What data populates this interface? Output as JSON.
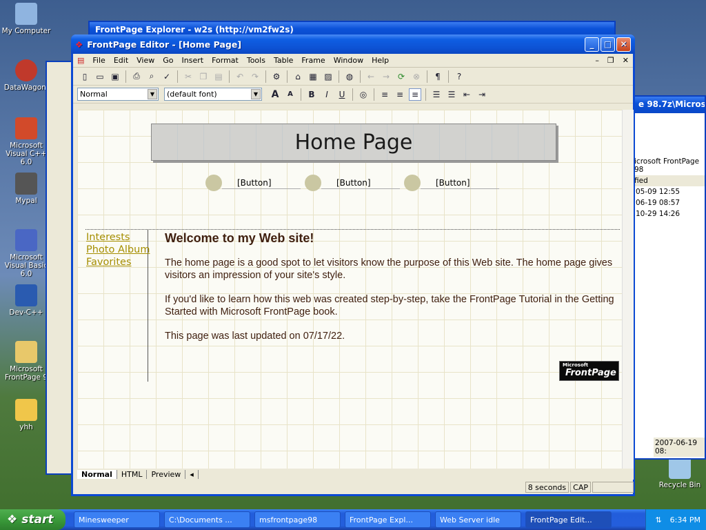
{
  "desktop": {
    "icons": [
      {
        "label": "My Computer",
        "color": "#8fb4e0"
      },
      {
        "label": "DataWagon.",
        "color": "#c0392b"
      },
      {
        "label": "Microsoft Visual C++ 6.0",
        "color": "#d24a2a"
      },
      {
        "label": "Mypal",
        "color": "#555555"
      },
      {
        "label": "Microsoft Visual Basic 6.0",
        "color": "#4a67c4"
      },
      {
        "label": "Dev-C++",
        "color": "#2a5bb0"
      },
      {
        "label": "Microsoft FrontPage 9",
        "color": "#e8c86a"
      },
      {
        "label": "yhh",
        "color": "#f0c64a"
      }
    ],
    "recycle_bin": "Recycle Bin"
  },
  "background_windows": {
    "explorer_title": "FrontPage Explorer - w2s (http://vm2fw2s)",
    "right_title": "e 98.7z\\Microsof",
    "right_header": "icrosoft FrontPage 98",
    "right_col": "fied",
    "right_rows": [
      "05-09 12:55",
      "06-19 08:57",
      "10-29 14:26"
    ],
    "right_status": "2007-06-19 08:"
  },
  "window": {
    "title": "FrontPage Editor - [Home Page]",
    "menu": [
      "File",
      "Edit",
      "View",
      "Go",
      "Insert",
      "Format",
      "Tools",
      "Table",
      "Frame",
      "Window",
      "Help"
    ],
    "style_combo": "Normal",
    "font_combo": "(default font)"
  },
  "page": {
    "banner": "Home Page",
    "nav_buttons": [
      "[Button]",
      "[Button]",
      "[Button]"
    ],
    "links": [
      "Interests",
      "Photo Album",
      "Favorites"
    ],
    "heading": "Welcome to my Web site!",
    "para1": "The home page is a good spot to let visitors know the purpose of this Web site. The home page gives visitors an impression of your site's style.",
    "para2": "If you'd like to learn how this web was created step-by-step, take the FrontPage Tutorial in the Getting Started with Microsoft FrontPage book.",
    "para3": "This page was last updated on 07/17/22.",
    "logo_small": "Microsoft",
    "logo_text": "FrontPage"
  },
  "tabs": [
    "Normal",
    "HTML",
    "Preview"
  ],
  "status": {
    "time": "8 seconds",
    "caps": "CAP"
  },
  "taskbar": {
    "start": "start",
    "items": [
      "Minesweeper",
      "C:\\Documents ...",
      "msfrontpage98",
      "FrontPage Expl...",
      "Web Server idle",
      "FrontPage Edit..."
    ],
    "clock": "6:34 PM"
  }
}
